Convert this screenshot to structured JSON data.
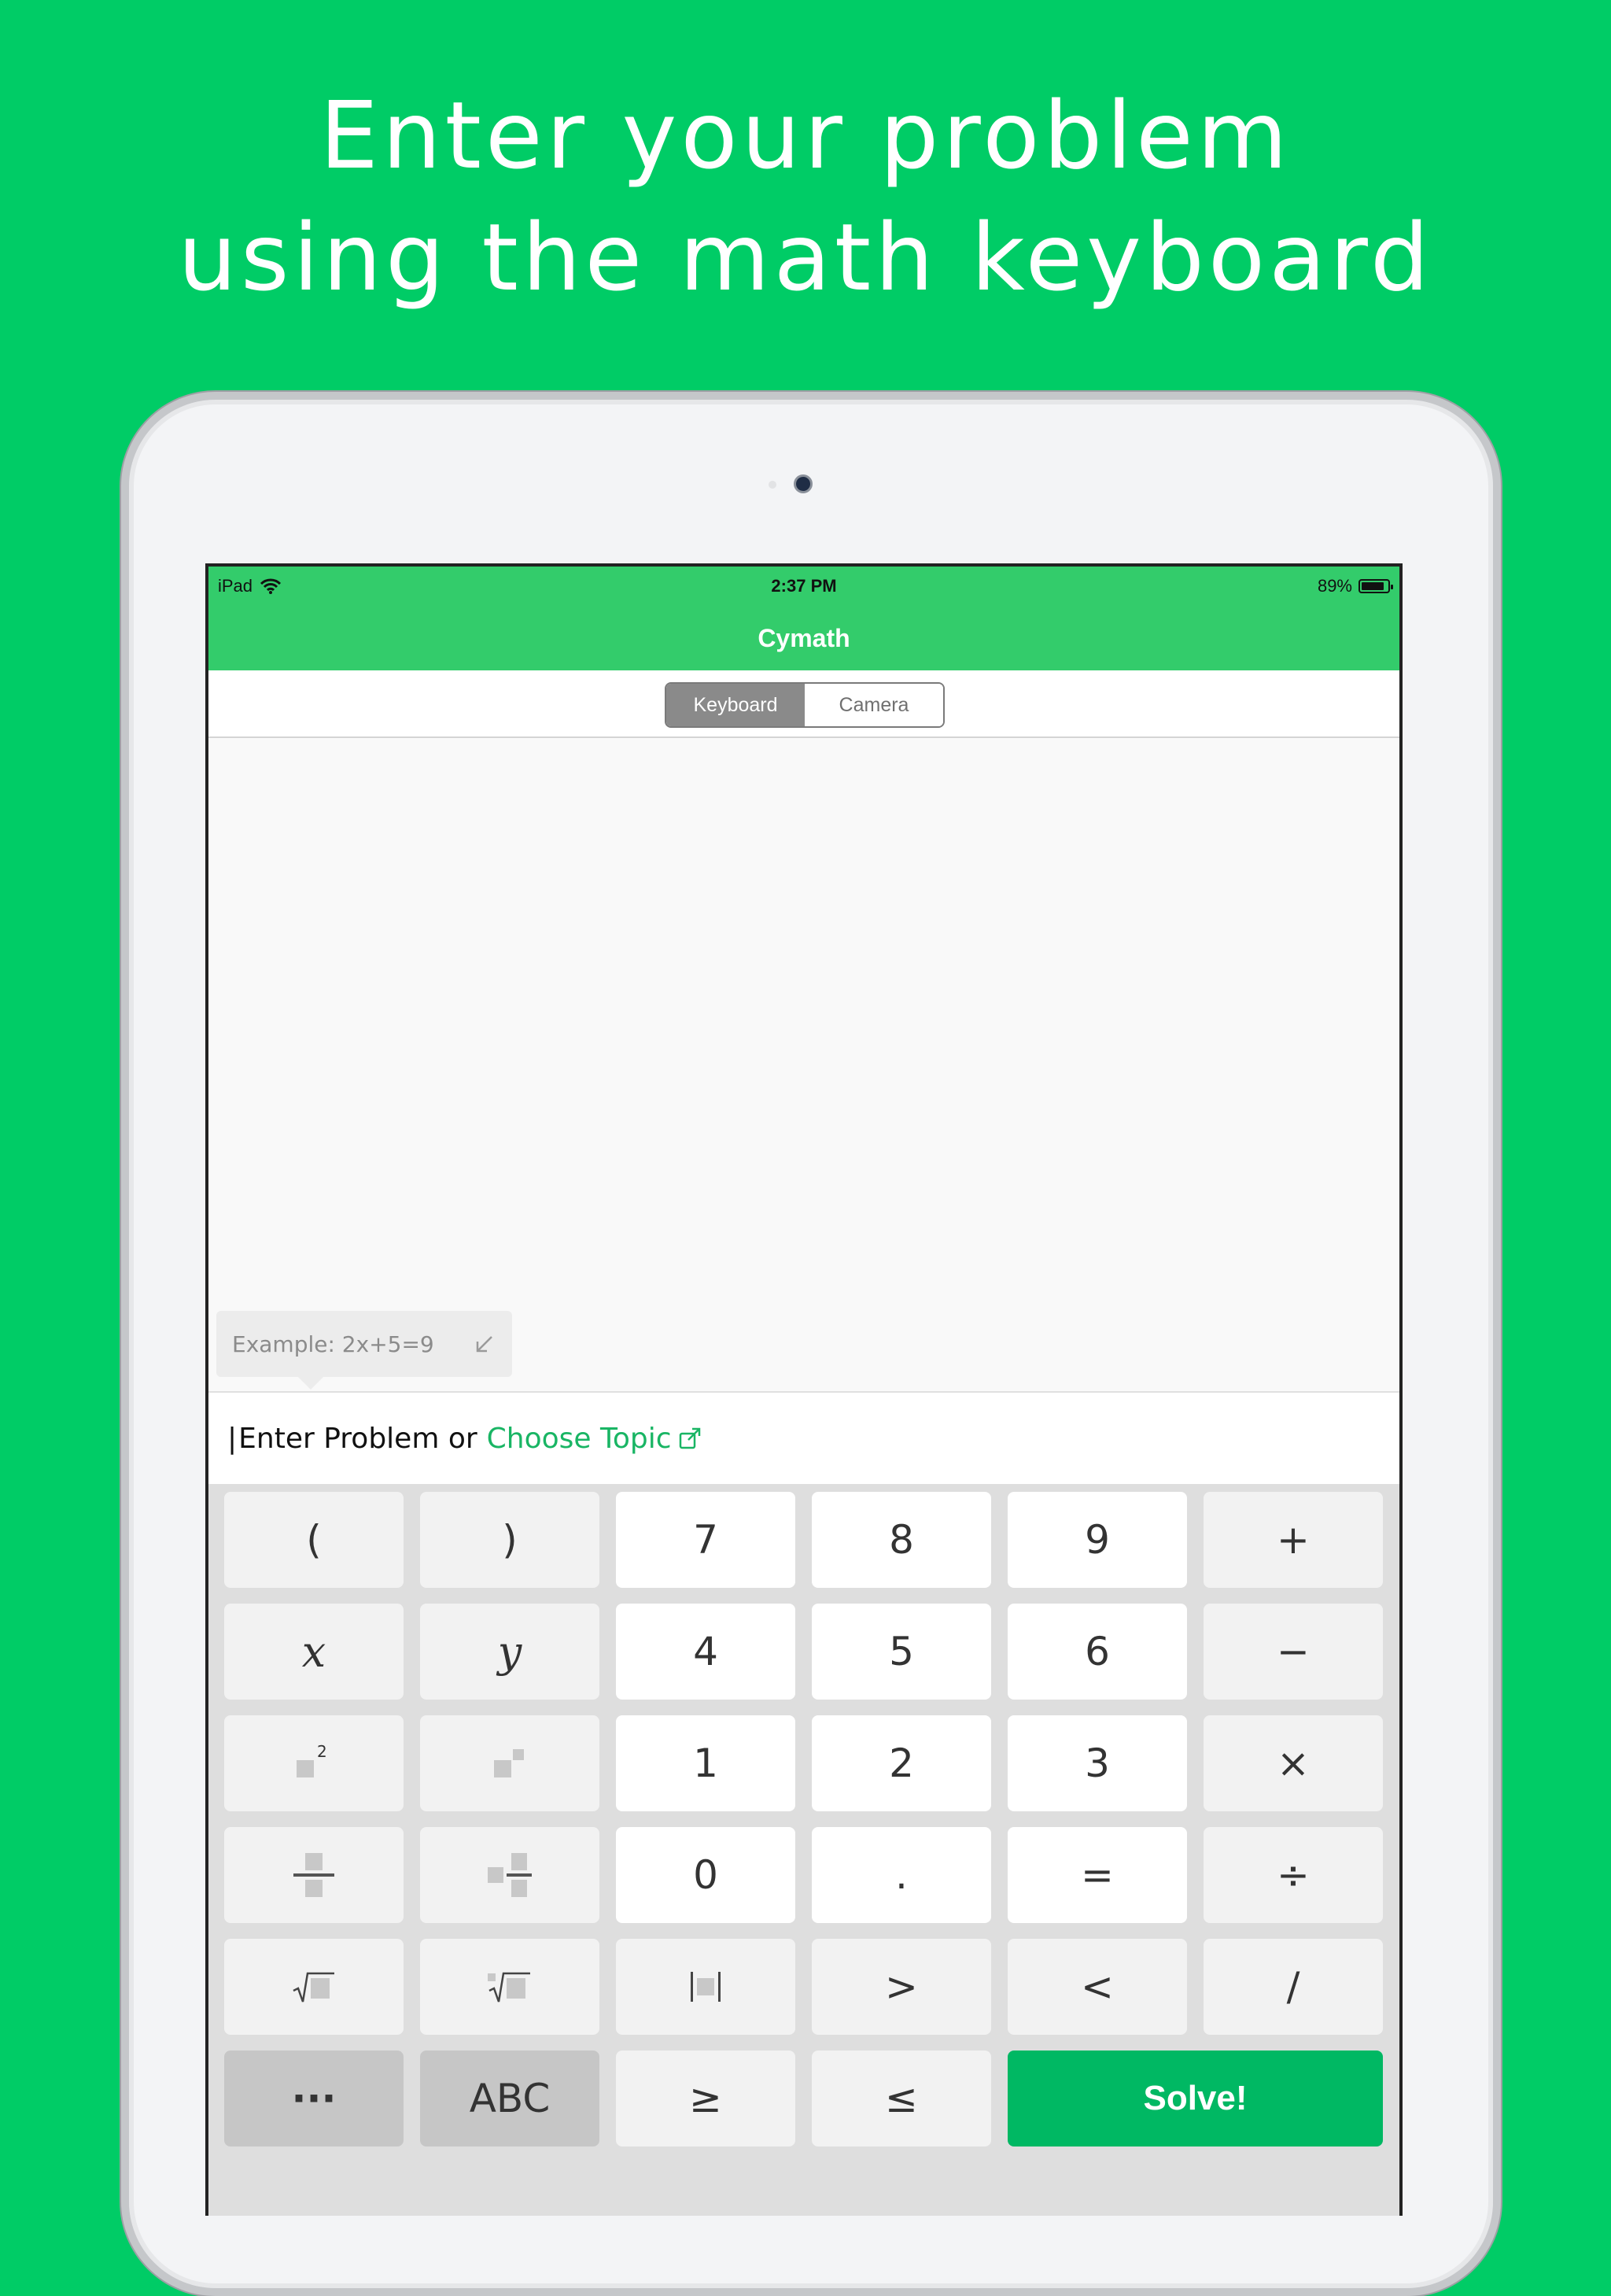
{
  "headline": {
    "line1": "Enter your problem",
    "line2": "using the math keyboard"
  },
  "status_bar": {
    "device": "iPad",
    "time": "2:37 PM",
    "battery_text": "89%",
    "battery_level": 0.89,
    "icons": [
      "wifi-icon",
      "battery-icon"
    ]
  },
  "app": {
    "title": "Cymath",
    "accent_color": "#33CC6B",
    "link_color": "#19B564",
    "solve_color": "#00B863"
  },
  "segmented_control": {
    "options": [
      "Keyboard",
      "Camera"
    ],
    "selected": "Keyboard"
  },
  "example_tip": {
    "text": "Example: 2x+5=9",
    "icon": "collapse-arrow-icon"
  },
  "input": {
    "caret": "|",
    "prompt": "Enter Problem or",
    "link_text": "Choose Topic",
    "link_icon": "external-link-icon"
  },
  "keypad": {
    "row1": [
      "(",
      ")",
      "7",
      "8",
      "9",
      "+"
    ],
    "row2": [
      "x",
      "y",
      "4",
      "5",
      "6",
      "−"
    ],
    "row3": [
      "square-icon",
      "power-icon",
      "1",
      "2",
      "3",
      "×"
    ],
    "row4": [
      "fraction-icon",
      "mixed-fraction-icon",
      "0",
      ".",
      "=",
      "÷"
    ],
    "row5": [
      "sqrt-icon",
      "nth-root-icon",
      "abs-value-icon",
      ">",
      "<",
      "/"
    ],
    "row6": [
      "···",
      "ABC",
      "≥",
      "≤",
      "Solve!"
    ],
    "superscript_two": "2"
  }
}
